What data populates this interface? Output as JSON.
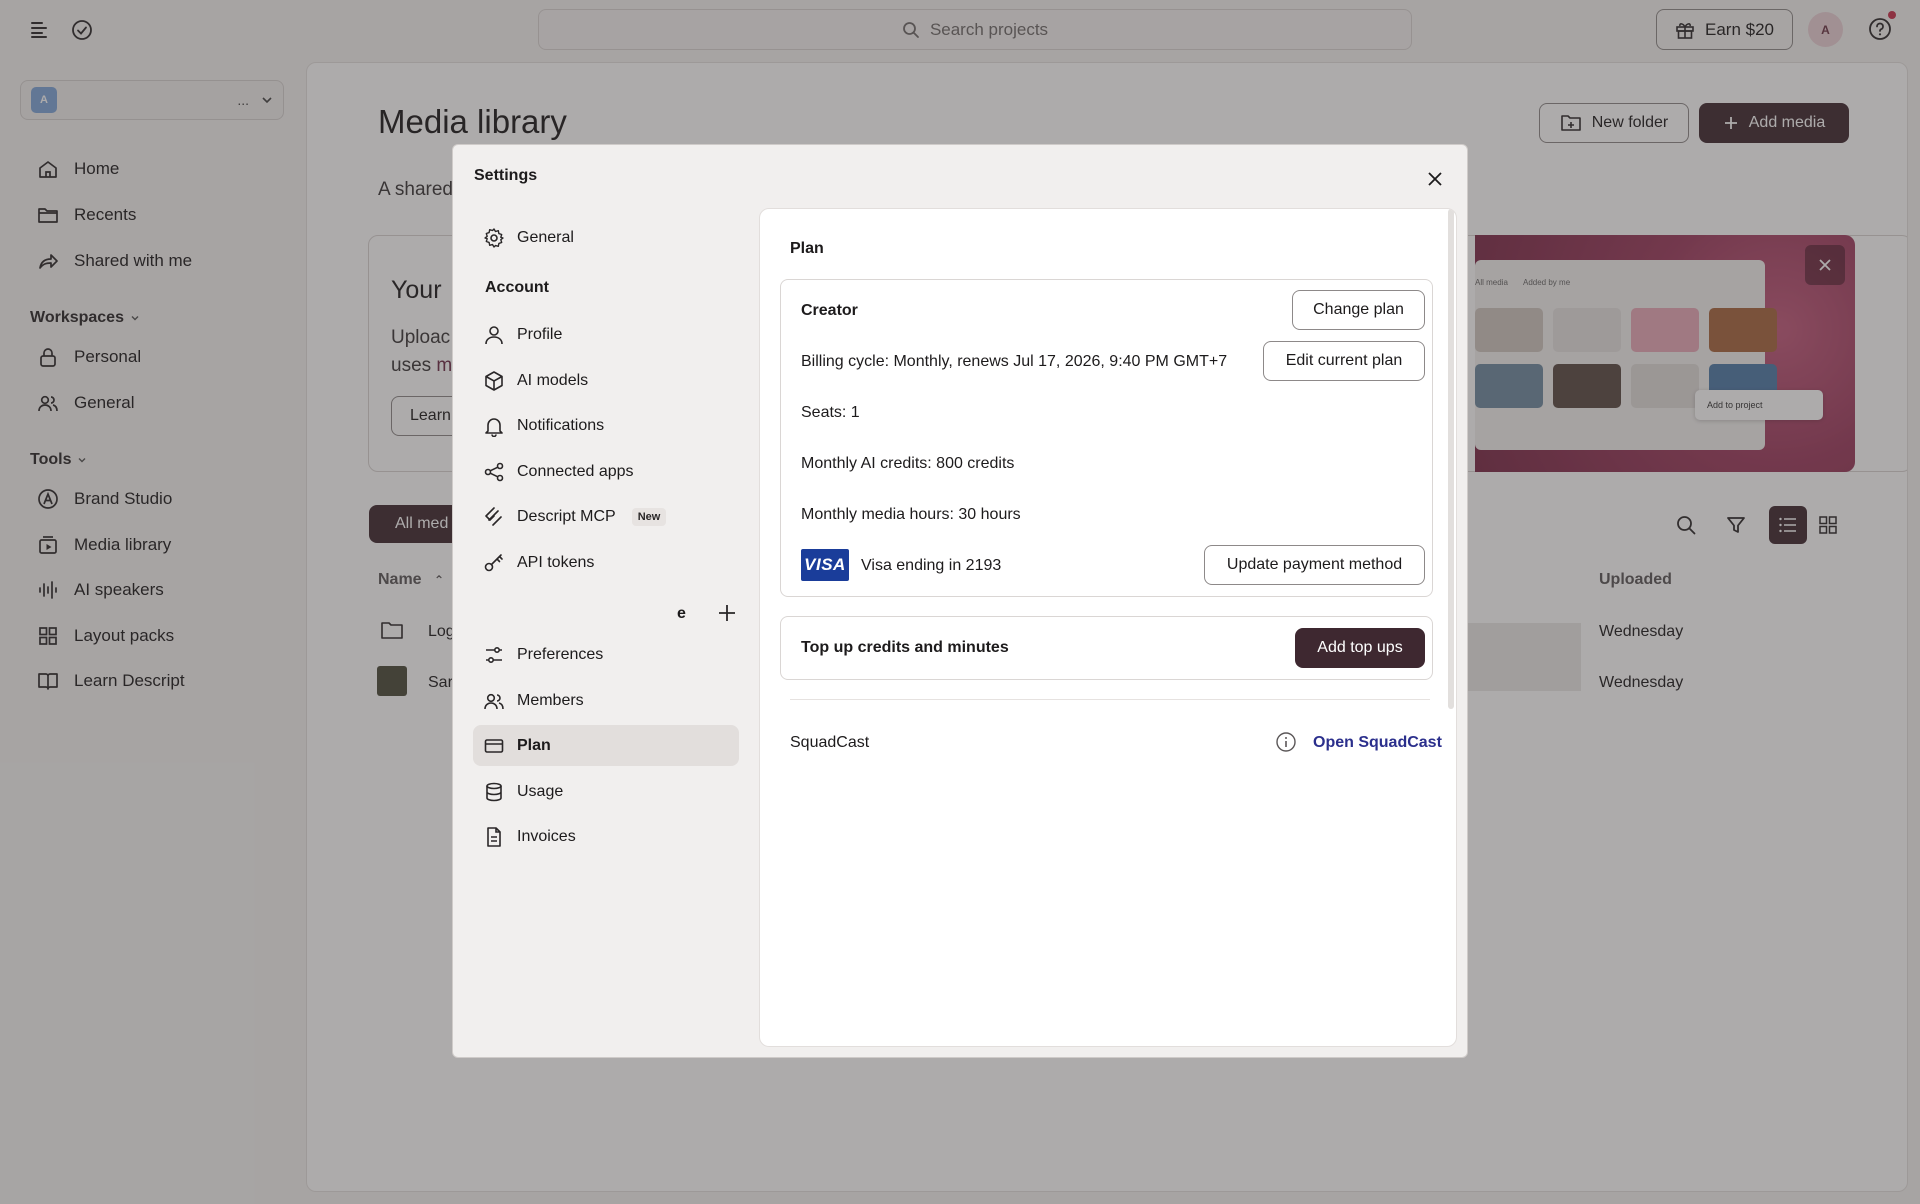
{
  "topbar": {
    "search_placeholder": "Search projects",
    "earn_label": "Earn $20",
    "avatar_initial": "A"
  },
  "sidebar": {
    "workspace_initial": "A",
    "workspace_dots": "...",
    "nav": [
      {
        "label": "Home",
        "icon": "home-icon"
      },
      {
        "label": "Recents",
        "icon": "folder-icon"
      },
      {
        "label": "Shared with me",
        "icon": "share-icon"
      }
    ],
    "workspaces_heading": "Workspaces",
    "workspaces": [
      {
        "label": "Personal",
        "icon": "lock-icon"
      },
      {
        "label": "General",
        "icon": "people-icon"
      }
    ],
    "tools_heading": "Tools",
    "tools": [
      {
        "label": "Brand Studio",
        "icon": "brand-icon"
      },
      {
        "label": "Media library",
        "icon": "media-icon"
      },
      {
        "label": "AI speakers",
        "icon": "waveform-icon"
      },
      {
        "label": "Layout packs",
        "icon": "grid-icon"
      },
      {
        "label": "Learn Descript",
        "icon": "book-icon"
      }
    ]
  },
  "main": {
    "title": "Media library",
    "subtitle": "A shared",
    "new_folder_label": "New folder",
    "add_media_label": "Add media",
    "promo": {
      "title": "Your",
      "body_line1": "Uploac",
      "body_line2": "uses",
      "body_link": "m",
      "learn_label": "Learn",
      "mock_tab1": "All media",
      "mock_tab2": "Added by me",
      "mock_add_label": "Add to project"
    },
    "tab_all_media": "All med",
    "columns": {
      "name": "Name",
      "uploaded": "Uploaded"
    },
    "rows": [
      {
        "name": "Log",
        "uploaded": "Wednesday"
      },
      {
        "name": "Sar",
        "uploaded": "Wednesday"
      }
    ]
  },
  "modal": {
    "title": "Settings",
    "nav_general": "General",
    "account_heading": "Account",
    "account_items": [
      {
        "label": "Profile",
        "icon": "person-icon"
      },
      {
        "label": "AI models",
        "icon": "cube-icon"
      },
      {
        "label": "Notifications",
        "icon": "bell-icon"
      },
      {
        "label": "Connected apps",
        "icon": "connected-icon"
      },
      {
        "label": "Descript MCP",
        "icon": "mcp-icon",
        "badge": "New"
      },
      {
        "label": "API tokens",
        "icon": "key-icon"
      }
    ],
    "workspace_heading_fragment": "e",
    "workspace_items": [
      {
        "label": "Preferences",
        "icon": "sliders-icon"
      },
      {
        "label": "Members",
        "icon": "members-icon"
      },
      {
        "label": "Plan",
        "icon": "card-icon",
        "active": true
      },
      {
        "label": "Usage",
        "icon": "database-icon"
      },
      {
        "label": "Invoices",
        "icon": "document-icon"
      }
    ],
    "panel": {
      "heading": "Plan",
      "plan_name": "Creator",
      "change_plan_label": "Change plan",
      "billing_cycle": "Billing cycle: Monthly, renews Jul 17, 2026, 9:40 PM GMT+7",
      "edit_plan_label": "Edit current plan",
      "seats": "Seats: 1",
      "ai_credits": "Monthly AI credits: 800 credits",
      "media_hours": "Monthly media hours: 30 hours",
      "card_brand": "VISA",
      "card_text": "Visa ending in 2193",
      "update_payment_label": "Update payment method",
      "topup_title": "Top up credits and minutes",
      "add_topups_label": "Add top ups",
      "squadcast_label": "SquadCast",
      "open_squadcast_label": "Open SquadCast"
    }
  },
  "colors": {
    "accent_dark": "#3e2830",
    "link_blue": "#2b2f8c",
    "visa_blue": "#1a3d9a",
    "notification_red": "#c8304a"
  }
}
